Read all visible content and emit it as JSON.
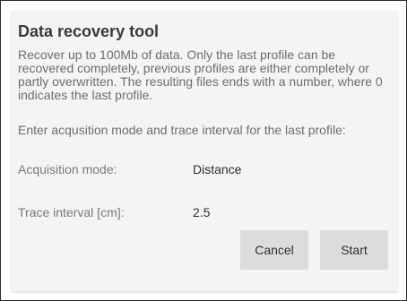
{
  "dialog": {
    "title": "Data recovery tool",
    "description": "Recover up to 100Mb of data. Only the last profile can be recovered completely, previous profiles are either completely or partly overwritten. The resulting files ends with a number, where 0 indicates the last profile.",
    "instruction": "Enter acqusition mode and trace interval for the last profile:",
    "fields": [
      {
        "label": "Acquisition mode:",
        "value": "Distance"
      },
      {
        "label": "Trace interval [cm]:",
        "value": "2.5"
      }
    ],
    "buttons": {
      "cancel_label": "Cancel",
      "start_label": "Start"
    }
  }
}
